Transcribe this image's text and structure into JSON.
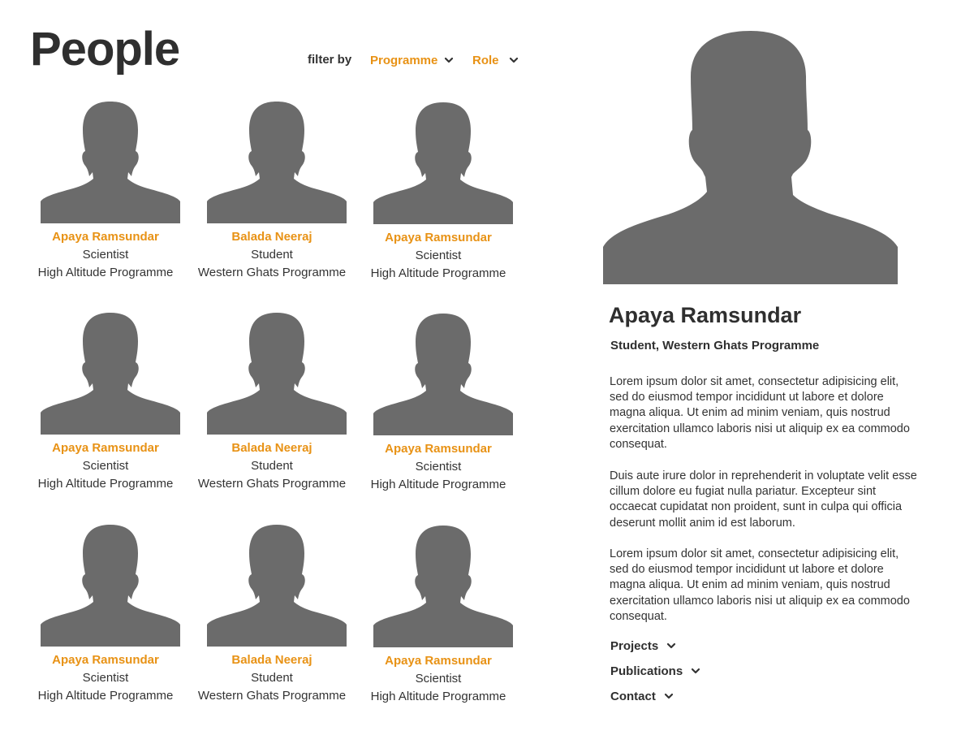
{
  "page": {
    "title": "People"
  },
  "filters": {
    "label": "filter by",
    "programme_label": "Programme",
    "role_label": "Role",
    "accent_color": "#e89215"
  },
  "people": [
    {
      "name": "Apaya Ramsundar",
      "role": "Scientist",
      "programme": "High Altitude Programme"
    },
    {
      "name": "Balada Neeraj",
      "role": "Student",
      "programme": "Western Ghats Programme"
    },
    {
      "name": "Apaya Ramsundar",
      "role": "Scientist",
      "programme": "High Altitude Programme"
    },
    {
      "name": "Apaya Ramsundar",
      "role": "Scientist",
      "programme": "High Altitude Programme"
    },
    {
      "name": "Balada Neeraj",
      "role": "Student",
      "programme": "Western Ghats Programme"
    },
    {
      "name": "Apaya Ramsundar",
      "role": "Scientist",
      "programme": "High Altitude Programme"
    },
    {
      "name": "Apaya Ramsundar",
      "role": "Scientist",
      "programme": "High Altitude Programme"
    },
    {
      "name": "Balada Neeraj",
      "role": "Student",
      "programme": "Western Ghats Programme"
    },
    {
      "name": "Apaya Ramsundar",
      "role": "Scientist",
      "programme": "High Altitude Programme"
    }
  ],
  "detail": {
    "name": "Apaya Ramsundar",
    "subtitle": "Student, Western Ghats Programme",
    "paragraphs": [
      "Lorem ipsum dolor sit amet, consectetur adipisicing elit, sed do eiusmod tempor incididunt ut labore et dolore magna aliqua. Ut enim ad minim veniam, quis nostrud exercitation ullamco laboris nisi ut aliquip ex ea commodo consequat.",
      "Duis aute irure dolor in reprehenderit in voluptate velit esse cillum dolore eu fugiat nulla pariatur. Excepteur sint occaecat cupidatat non proident, sunt in culpa qui officia deserunt mollit anim id est laborum.",
      "Lorem ipsum dolor sit amet, consectetur adipisicing elit, sed do eiusmod tempor incididunt ut labore et dolore magna aliqua. Ut enim ad minim veniam, quis nostrud exercitation ullamco laboris nisi ut aliquip ex ea commodo consequat."
    ],
    "sections": [
      {
        "label": "Projects"
      },
      {
        "label": "Publications"
      },
      {
        "label": "Contact"
      }
    ]
  },
  "icons": {
    "avatar": "person-silhouette-icon",
    "chevron": "chevron-down-icon"
  },
  "colors": {
    "accent": "#e89215",
    "silhouette": "#6b6b6b",
    "text": "#333333"
  }
}
